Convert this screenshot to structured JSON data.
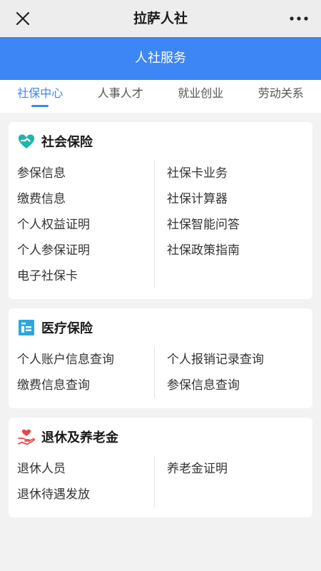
{
  "window": {
    "title": "拉萨人社"
  },
  "header": {
    "title": "人社服务"
  },
  "tabs": [
    {
      "label": "社保中心",
      "active": true
    },
    {
      "label": "人事人才",
      "active": false
    },
    {
      "label": "就业创业",
      "active": false
    },
    {
      "label": "劳动关系",
      "active": false
    }
  ],
  "colors": {
    "accent": "#3d86f5",
    "social_icon": "#1fb5ac",
    "medical_icon": "#29a8e0",
    "retire_icon": "#e5484d"
  },
  "sections": [
    {
      "title": "社会保险",
      "icon": "heart-hand-icon",
      "left": [
        "参保信息",
        "缴费信息",
        "个人权益证明",
        "个人参保证明",
        "电子社保卡"
      ],
      "right": [
        "社保卡业务",
        "社保计算器",
        "社保智能问答",
        "社保政策指南"
      ]
    },
    {
      "title": "医疗保险",
      "icon": "document-icon",
      "left": [
        "个人账户信息查询",
        "缴费信息查询"
      ],
      "right": [
        "个人报销记录查询",
        "参保信息查询"
      ]
    },
    {
      "title": "退休及养老金",
      "icon": "hand-heart-icon",
      "left": [
        "退休人员",
        "退休待遇发放"
      ],
      "right": [
        "养老金证明"
      ]
    }
  ]
}
